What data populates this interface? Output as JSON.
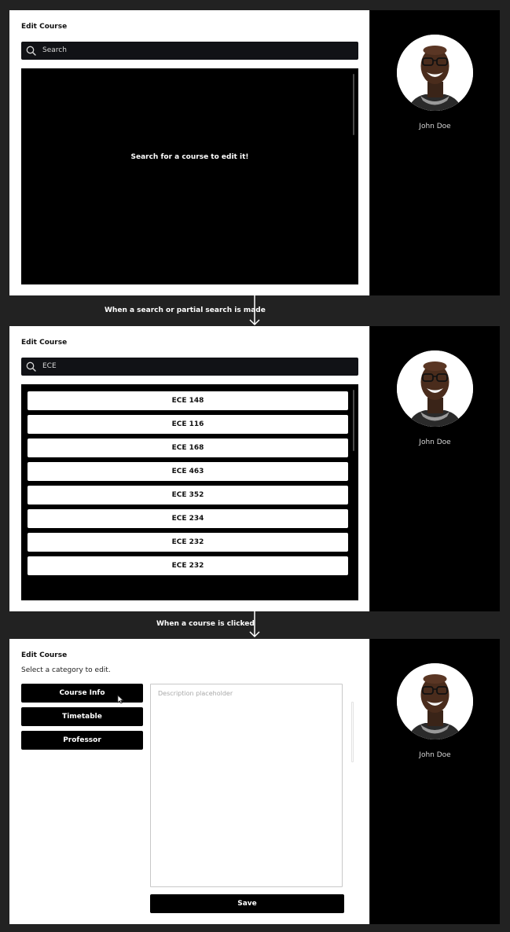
{
  "user": {
    "name": "John Doe"
  },
  "screen1": {
    "title": "Edit Course",
    "search": {
      "value": "Search"
    },
    "empty_message": "Search for a course to edit it!"
  },
  "connector1": {
    "label": "When a search or partial search is made"
  },
  "screen2": {
    "title": "Edit Course",
    "search": {
      "value": "ECE"
    },
    "results": [
      {
        "label": "ECE 148"
      },
      {
        "label": "ECE 116"
      },
      {
        "label": "ECE 168"
      },
      {
        "label": "ECE 463"
      },
      {
        "label": "ECE 352"
      },
      {
        "label": "ECE 234"
      },
      {
        "label": "ECE 232"
      },
      {
        "label": "ECE 232"
      }
    ]
  },
  "connector2": {
    "label": "When a course is clicked"
  },
  "screen3": {
    "title": "Edit Course",
    "subtitle": "Select a category to edit.",
    "categories": [
      {
        "label": "Course Info"
      },
      {
        "label": "Timetable"
      },
      {
        "label": "Professor"
      }
    ],
    "description": {
      "placeholder": "Description placeholder"
    },
    "save_label": "Save"
  },
  "icons": {
    "search": "search-icon",
    "arrow": "arrow-down-icon",
    "cursor": "mouse-pointer-icon",
    "avatar": "user-avatar-photo"
  },
  "colors": {
    "page_background": "#222222",
    "panel_dark": "#000000",
    "search_bar": "#111216",
    "card": "#ffffff"
  }
}
